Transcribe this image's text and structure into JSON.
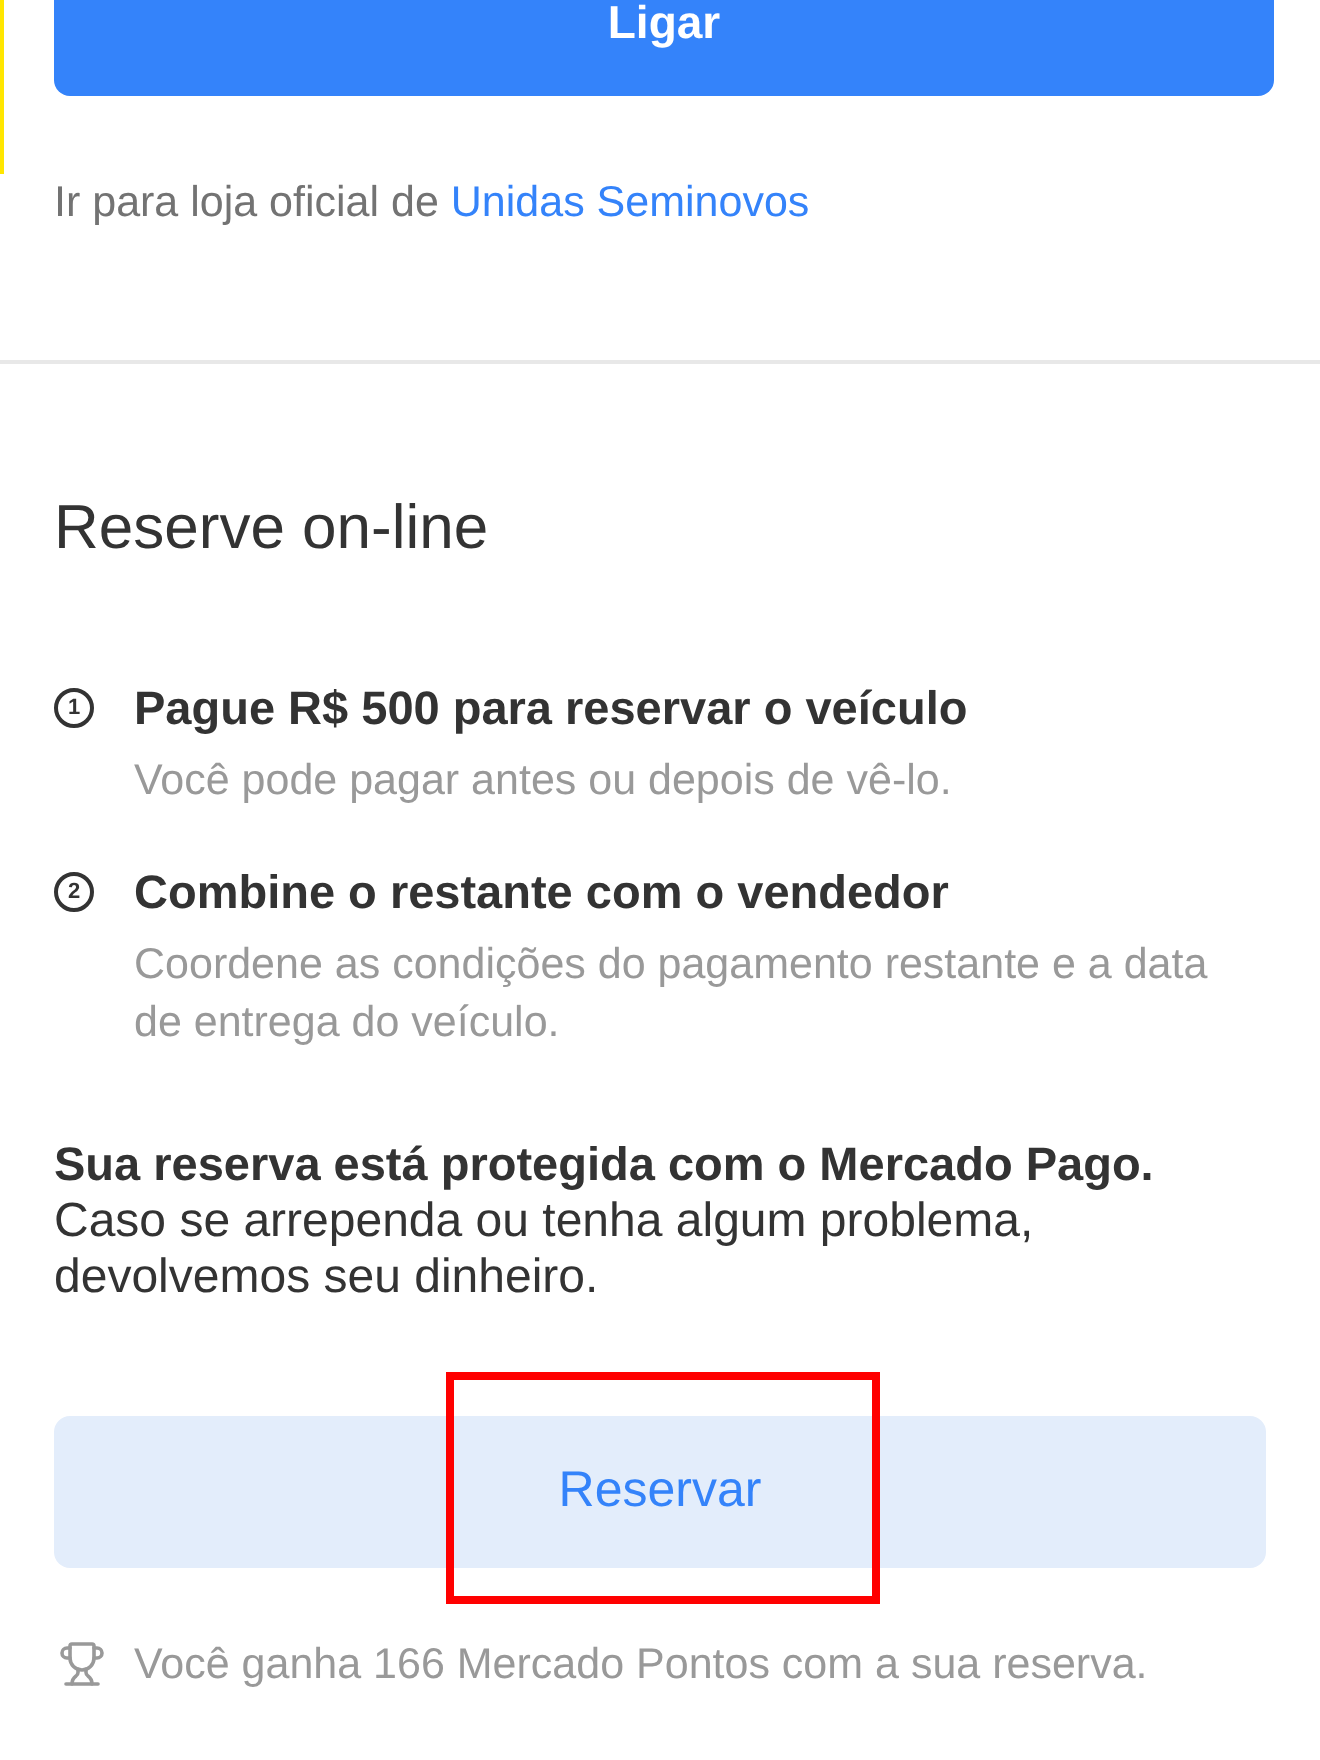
{
  "call_button": {
    "label": "Ligar"
  },
  "store_line": {
    "text": "Ir para loja oficial de",
    "link": "Unidas Seminovos"
  },
  "reserve_section": {
    "title": "Reserve on-line",
    "steps": [
      {
        "number": "1",
        "title": "Pague R$ 500 para reservar o veículo",
        "description": "Você pode pagar antes ou depois de vê-lo."
      },
      {
        "number": "2",
        "title": "Combine o restante com o vendedor",
        "description": "Coordene as condições do pagamento restante e a data de entrega do veículo."
      }
    ],
    "protection": {
      "title": "Sua reserva está protegida com o Mercado Pago.",
      "text": "Caso se arrependa ou tenha algum problema, devolvemos seu dinheiro."
    },
    "reserve_button": {
      "label": "Reservar",
      "highlighted": true
    },
    "points_note": {
      "text": "Você ganha 166 Mercado Pontos com a sua reserva."
    }
  }
}
